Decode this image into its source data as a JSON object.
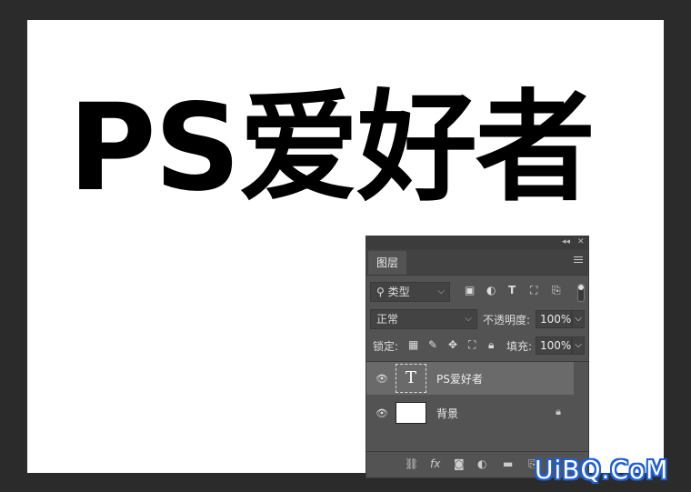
{
  "canvas": {
    "text": "PS爱好者"
  },
  "panel": {
    "tab_label": "图层",
    "filter": {
      "selected": "类型",
      "icons": [
        "image-filter-icon",
        "adjustment-filter-icon",
        "type-filter-icon",
        "shape-filter-icon",
        "smart-object-filter-icon"
      ]
    },
    "blend_mode": "正常",
    "opacity_label": "不透明度:",
    "opacity_value": "100%",
    "lock_label": "锁定:",
    "fill_label": "填充:",
    "fill_value": "100%",
    "layers": [
      {
        "name": "PS爱好者",
        "type": "text",
        "thumb_glyph": "T",
        "selected": true
      },
      {
        "name": "背景",
        "type": "background",
        "locked": true
      }
    ]
  },
  "watermark": "UiBQ.CoM",
  "colors": {
    "app_bg": "#2b2b2b",
    "panel_bg": "#535353",
    "selected_row": "#6a6a6a",
    "watermark_outline": "#1f5fd6"
  }
}
